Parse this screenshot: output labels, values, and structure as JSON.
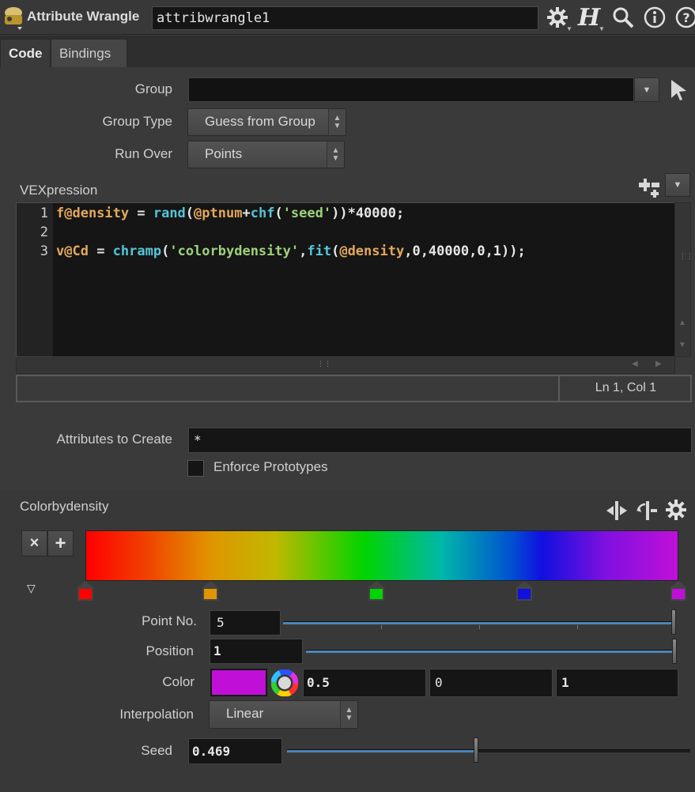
{
  "header": {
    "node_type": "Attribute Wrangle",
    "node_name": "attribwrangle1",
    "icons": [
      "node-icon",
      "gear-icon",
      "help-h-icon",
      "search-icon",
      "info-icon",
      "help-icon"
    ]
  },
  "tabs": [
    {
      "label": "Code",
      "active": true
    },
    {
      "label": "Bindings",
      "active": false
    }
  ],
  "params": {
    "group_label": "Group",
    "group_value": "",
    "group_type_label": "Group Type",
    "group_type_value": "Guess from Group",
    "run_over_label": "Run Over",
    "run_over_value": "Points",
    "vex_label": "VEXpression"
  },
  "editor": {
    "line_numbers": [
      "1",
      "2",
      "3"
    ],
    "lines": [
      "f@density = rand(@ptnum+chf('seed'))*40000;",
      "",
      "v@Cd = chramp('colorbydensity',fit(@density,0,40000,0,1));"
    ],
    "line1": {
      "t1": "f@density",
      "t2": " = ",
      "t3": "rand",
      "t4": "(",
      "t5": "@ptnum",
      "t6": "+",
      "t7": "chf",
      "t8": "(",
      "t9": "'seed'",
      "t10": "))*40000;"
    },
    "line3": {
      "t1": "v@Cd",
      "t2": " = ",
      "t3": "chramp",
      "t4": "(",
      "t5": "'colorbydensity'",
      "t6": ",",
      "t7": "fit",
      "t8": "(",
      "t9": "@density",
      "t10": ",0,40000,0,1));"
    },
    "status": "Ln 1, Col 1"
  },
  "attributes": {
    "create_label": "Attributes to Create",
    "create_value": "*",
    "enforce_label": "Enforce Prototypes",
    "enforce_checked": false
  },
  "ramp": {
    "label": "Colorbydensity",
    "keys": [
      {
        "position": 0,
        "color": "#ff0000"
      },
      {
        "position": 0.21,
        "color": "#e09500"
      },
      {
        "position": 0.49,
        "color": "#00d400"
      },
      {
        "position": 0.74,
        "color": "#1010e0"
      },
      {
        "position": 1,
        "color": "#c010d8"
      }
    ],
    "point_no_label": "Point No.",
    "point_no_value": "5",
    "point_no_fraction": 1.0,
    "position_label": "Position",
    "position_value": "1",
    "position_fraction": 1.0,
    "color_label": "Color",
    "color_swatch": "#c010d8",
    "color_r": "0.5",
    "color_g": "0",
    "color_b": "1",
    "interp_label": "Interpolation",
    "interp_value": "Linear"
  },
  "seed": {
    "label": "Seed",
    "value": "0.469",
    "fraction": 0.469
  }
}
